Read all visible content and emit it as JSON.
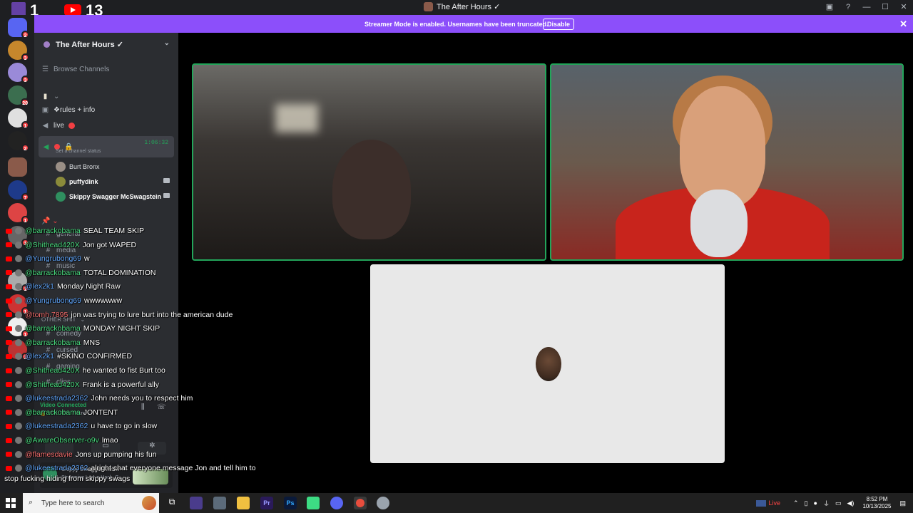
{
  "window": {
    "title": "The After Hours ✓"
  },
  "overlay": {
    "twitch_count": "1",
    "youtube_count": "13"
  },
  "banner": {
    "text": "Streamer Mode is enabled. Usernames have been truncated.",
    "button": "Disable",
    "close": "✕"
  },
  "rail": {
    "badges": [
      "2",
      "3",
      "3",
      "20",
      "1",
      "2",
      "7",
      "1",
      "1",
      "1",
      "1",
      "1",
      "3"
    ]
  },
  "sidebar": {
    "server_name": "The After Hours ✓",
    "browse": "Browse Channels",
    "rules": "❖rules + info",
    "live": "live",
    "voice_timer": "1:06:32",
    "set_status": "Set a channel status",
    "voice_users": [
      "Burt Bronx",
      "puffydink",
      "Skippy Swagger McSwagstein"
    ],
    "category": "OTHER SHIT",
    "channels": [
      "general",
      "media",
      "music",
      "comedy",
      "cursed",
      "gaming",
      "clips"
    ],
    "footer": {
      "video_connected": "Video Connected",
      "server_path": "🔒 / The After Hours",
      "user": "Skippy Swagger McSw",
      "status": "Streaming I am a Hack, G..."
    }
  },
  "chat": [
    {
      "user": "@barrackobama",
      "msg": "SEAL TEAM SKIP",
      "color": "#4ade80"
    },
    {
      "user": "@Shithead420X",
      "msg": "Jon got WAPED",
      "color": "#4ade80"
    },
    {
      "user": "@Yungrubong69",
      "msg": "w",
      "color": "#60a5fa"
    },
    {
      "user": "@barrackobama",
      "msg": "TOTAL DOMINATION",
      "color": "#4ade80"
    },
    {
      "user": "@lex2k1",
      "msg": "Monday Night Raw",
      "color": "#60a5fa"
    },
    {
      "user": "@Yungrubong69",
      "msg": "wwwwwww",
      "color": "#60a5fa"
    },
    {
      "user": "@tomh.7895",
      "msg": "jon was trying to lure burt into the american dude",
      "color": "#f87171"
    },
    {
      "user": "@barrackobama",
      "msg": "MONDAY NIGHT SKIP",
      "color": "#4ade80"
    },
    {
      "user": "@barrackobama",
      "msg": "MNS",
      "color": "#4ade80"
    },
    {
      "user": "@lex2k1",
      "msg": "#SKINO CONFIRMED",
      "color": "#60a5fa"
    },
    {
      "user": "@Shithead420X",
      "msg": "he wanted to fist Burt too",
      "color": "#4ade80"
    },
    {
      "user": "@Shithead420X",
      "msg": "Frank is a powerful ally",
      "color": "#4ade80"
    },
    {
      "user": "@lukeestrada2362",
      "msg": "John needs you to respect him",
      "color": "#60a5fa"
    },
    {
      "user": "@barrackobama",
      "msg": "JONTENT",
      "color": "#4ade80"
    },
    {
      "user": "@lukeestrada2362",
      "msg": "u have to go in slow",
      "color": "#60a5fa"
    },
    {
      "user": "@AwareObserver-o9v",
      "msg": "lmao",
      "color": "#4ade80"
    },
    {
      "user": "@flamesdavie",
      "msg": "Jons up pumping his fun",
      "color": "#f87171"
    },
    {
      "user": "@lukeestrada2362",
      "msg": "alright chat everyone message Jon and tell him to",
      "color": "#60a5fa"
    }
  ],
  "chat_continuation": "stop fucking hiding from skippy swags",
  "taskbar": {
    "search_placeholder": "Type here to search",
    "live_label": "Live",
    "time": "8:52 PM",
    "date": "10/13/2025"
  },
  "colors": {
    "accent": "#8c4ffa",
    "speaking": "#23a55a",
    "danger": "#f23f43"
  }
}
